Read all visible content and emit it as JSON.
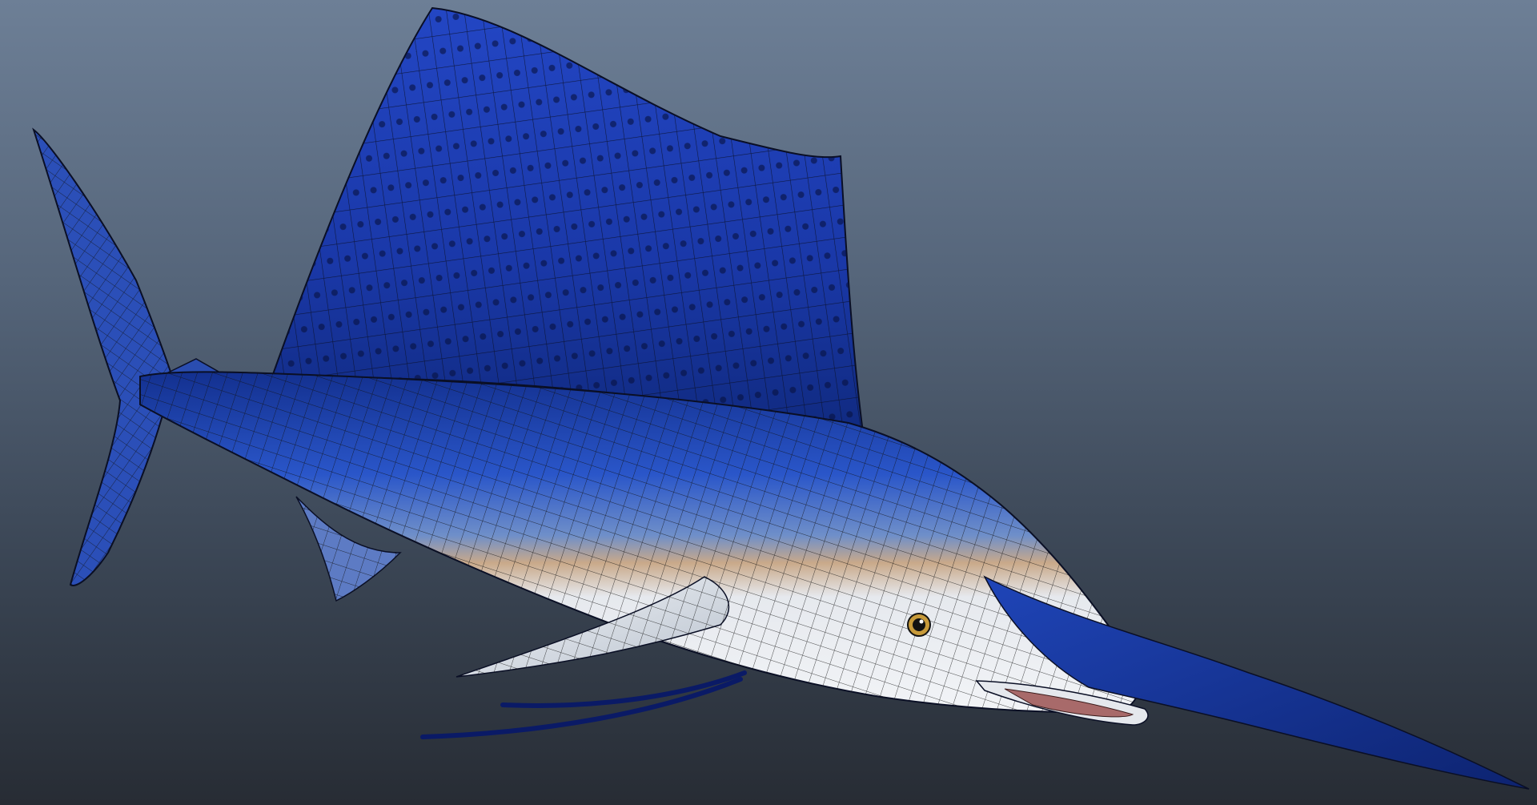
{
  "viewport": {
    "background_top": "#6d7f96",
    "background_bottom": "#272c34"
  },
  "model": {
    "subject": "sailfish-3d-model",
    "display_mode": "textured-wireframe",
    "colors": {
      "dorsal": "#1b3fb0",
      "dorsal_dark": "#0d1f66",
      "belly": "#e9edf2",
      "lateral_stripe": "#c9a98a",
      "wire": "#111111",
      "mouth": "#a86a6a",
      "eye": "#c79a3a"
    }
  }
}
